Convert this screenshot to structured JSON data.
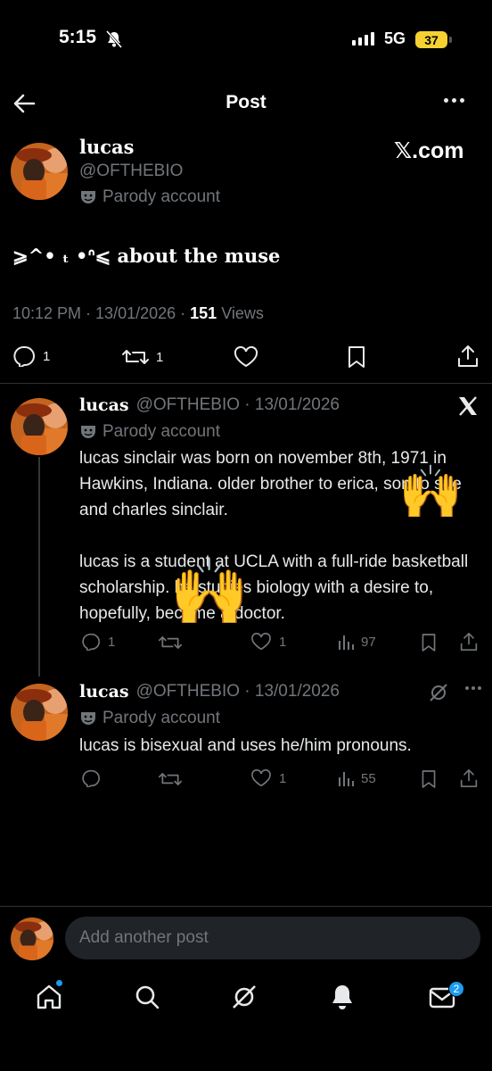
{
  "status_bar": {
    "time": "5:15",
    "network": "5G",
    "battery": "37"
  },
  "header": {
    "title": "Post"
  },
  "main_post": {
    "name": "lucas",
    "handle": "@OFTHEBIO",
    "parody_label": "Parody account",
    "watermark": "𝕏.com",
    "text": "⩾^• ₜ •ᐢ⩽ about the muse",
    "time": "10:12 PM",
    "date": "13/01/2026",
    "views_count": "151",
    "views_label": "Views",
    "reply_count": "1",
    "repost_count": "1"
  },
  "replies": [
    {
      "name": "lucas",
      "handle_date": "@OFTHEBIO · 13/01/2026",
      "parody_label": "Parody account",
      "paragraph1": "lucas sinclair was born on november 8th, 1971 in Hawkins, Indiana. older brother to erica, son to sue and charles sinclair.",
      "paragraph2": "lucas is a student at UCLA with a full-ride basketball scholarship. he studies biology with a desire to, hopefully, become a doctor.",
      "reply_count": "1",
      "like_count": "1",
      "views_count": "97"
    },
    {
      "name": "lucas",
      "handle_date": "@OFTHEBIO · 13/01/2026",
      "parody_label": "Parody account",
      "paragraph1": "lucas is bisexual and uses he/him pronouns.",
      "like_count": "1",
      "views_count": "55"
    }
  ],
  "stickers": [
    "🙌",
    "🙌"
  ],
  "composer": {
    "placeholder": "Add another post"
  },
  "bottom_nav": {
    "items": [
      "home-icon",
      "search-icon",
      "grok-icon",
      "notifications-icon",
      "messages-icon"
    ],
    "messages_badge": "2"
  },
  "colors": {
    "background": "#000000",
    "muted": "#71767b",
    "accent": "#1d9bf0",
    "divider": "#2f3336",
    "battery": "#f5d132"
  }
}
